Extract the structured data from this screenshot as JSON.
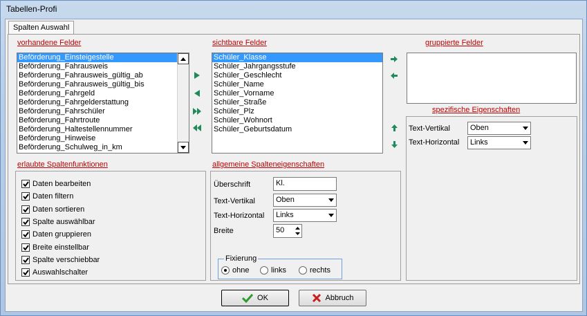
{
  "window": {
    "title": "Tabellen-Profi"
  },
  "tab": {
    "label": "Spalten Auswahl"
  },
  "vorhandene": {
    "label": "vorhandene Felder",
    "items": [
      "Beförderung_Einsteigestelle",
      "Beförderung_Fahrausweis",
      "Beförderung_Fahrausweis_gültig_ab",
      "Beförderung_Fahrausweis_gültig_bis",
      "Beförderung_Fahrgeld",
      "Beförderung_Fahrgelderstattung",
      "Beförderung_Fahrschüler",
      "Beförderung_Fahrtroute",
      "Beförderung_Haltestellennummer",
      "Beförderung_Hinweise",
      "Beförderung_Schulweg_in_km"
    ]
  },
  "sichtbare": {
    "label": "sichtbare Felder",
    "items": [
      "Schüler_Klasse",
      "Schüler_Jahrgangsstufe",
      "Schüler_Geschlecht",
      "Schüler_Name",
      "Schüler_Vorname",
      "Schüler_Straße",
      "Schüler_Plz",
      "Schüler_Wohnort",
      "Schüler_Geburtsdatum"
    ]
  },
  "gruppierte": {
    "label": "gruppierte Felder"
  },
  "spezifische": {
    "label": "spezifische Eigenschaften",
    "text_vertikal_label": "Text-Vertikal",
    "text_vertikal_value": "Oben",
    "text_horizontal_label": "Text-Horizontal",
    "text_horizontal_value": "Links"
  },
  "erlaubte": {
    "label": "erlaubte Spaltenfunktionen",
    "items": [
      "Daten bearbeiten",
      "Daten filtern",
      "Daten sortieren",
      "Spalte auswählbar",
      "Daten gruppieren",
      "Breite einstellbar",
      "Spalte verschiebbar",
      "Auswahlschalter"
    ]
  },
  "allgemeine": {
    "label": "allgemeine Spalteneigenschaften",
    "ueberschrift_label": "Überschrift",
    "ueberschrift_value": "Kl.",
    "text_vertikal_label": "Text-Vertikal",
    "text_vertikal_value": "Oben",
    "text_horizontal_label": "Text-Horizontal",
    "text_horizontal_value": "Links",
    "breite_label": "Breite",
    "breite_value": "50",
    "fixierung_label": "Fixierung",
    "radio_ohne": "ohne",
    "radio_links": "links",
    "radio_rechts": "rechts"
  },
  "buttons": {
    "ok": "OK",
    "abbruch": "Abbruch"
  },
  "colors": {
    "accent": "#3399ff",
    "section_label": "#c00000",
    "arrow_green": "#1f8a5a"
  }
}
